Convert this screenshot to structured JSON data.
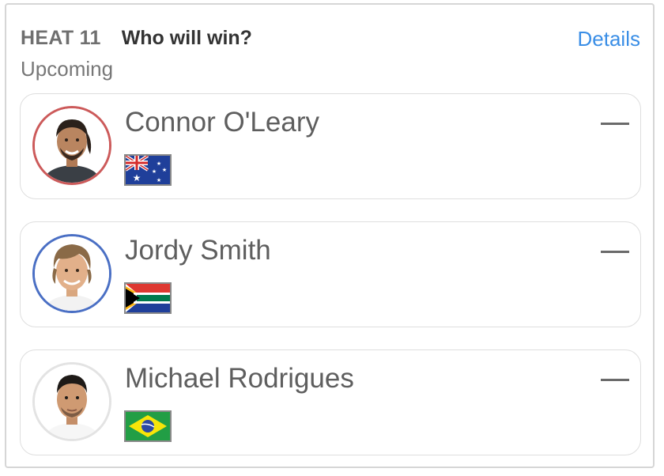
{
  "header": {
    "heat_label": "HEAT 11",
    "question": "Who will win?",
    "details_label": "Details",
    "status": "Upcoming"
  },
  "colors": {
    "accent_link": "#3a8ee6",
    "ring_red": "#cc5a5a",
    "ring_blue": "#4a6fc4",
    "ring_grey": "#e3e3e3"
  },
  "surfers": [
    {
      "name": "Connor O'Leary",
      "flag": "australia-flag",
      "ring": "red",
      "pick": "—"
    },
    {
      "name": "Jordy Smith",
      "flag": "south-africa-flag",
      "ring": "blue",
      "pick": "—"
    },
    {
      "name": "Michael Rodrigues",
      "flag": "brazil-flag",
      "ring": "grey",
      "pick": "—"
    }
  ]
}
